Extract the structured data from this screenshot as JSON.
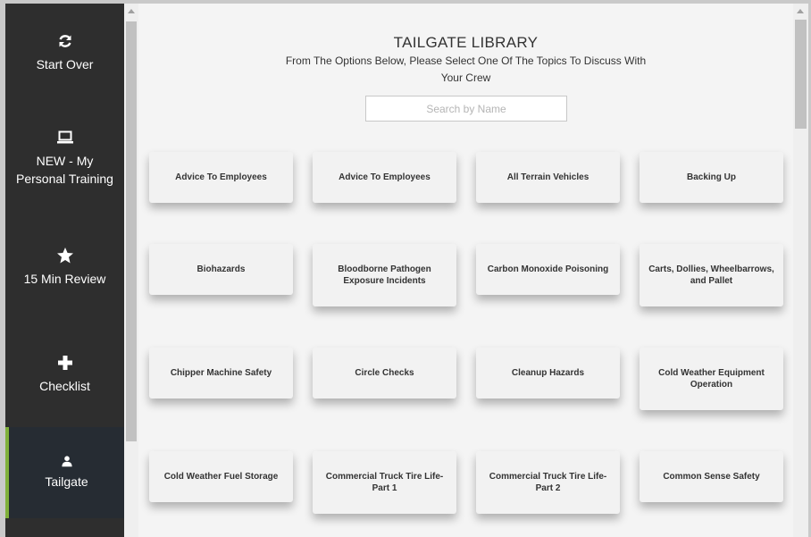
{
  "sidebar": {
    "items": [
      {
        "label": "Start Over",
        "icon": "refresh-icon"
      },
      {
        "label": "NEW - My Personal Training",
        "icon": "laptop-icon"
      },
      {
        "label": "15 Min Review",
        "icon": "star-icon"
      },
      {
        "label": "Checklist",
        "icon": "plus-icon"
      },
      {
        "label": "Tailgate",
        "icon": "user-icon",
        "active": true
      }
    ]
  },
  "main": {
    "title": "TAILGATE LIBRARY",
    "subtitle": "From The Options Below, Please Select One Of The Topics To Discuss With Your Crew",
    "search": {
      "placeholder": "Search by Name",
      "value": ""
    },
    "topics": [
      "Advice To Employees",
      "Advice To Employees",
      "All Terrain Vehicles",
      "Backing Up",
      "Biohazards",
      "Bloodborne Pathogen Exposure Incidents",
      "Carbon Monoxide Poisoning",
      "Carts, Dollies, Wheelbarrows, and Pallet",
      "Chipper Machine Safety",
      "Circle Checks",
      "Cleanup Hazards",
      "Cold Weather Equipment Operation",
      "Cold Weather Fuel Storage",
      "Commercial Truck Tire Life- Part 1",
      "Commercial Truck Tire Life- Part 2",
      "Common Sense Safety"
    ]
  },
  "colors": {
    "sidebar_bg": "#2e2e2e",
    "active_bg": "#262c33",
    "active_accent": "#7fb03a",
    "main_bg": "#f4f4f4",
    "card_bg": "#f2f2f2"
  }
}
